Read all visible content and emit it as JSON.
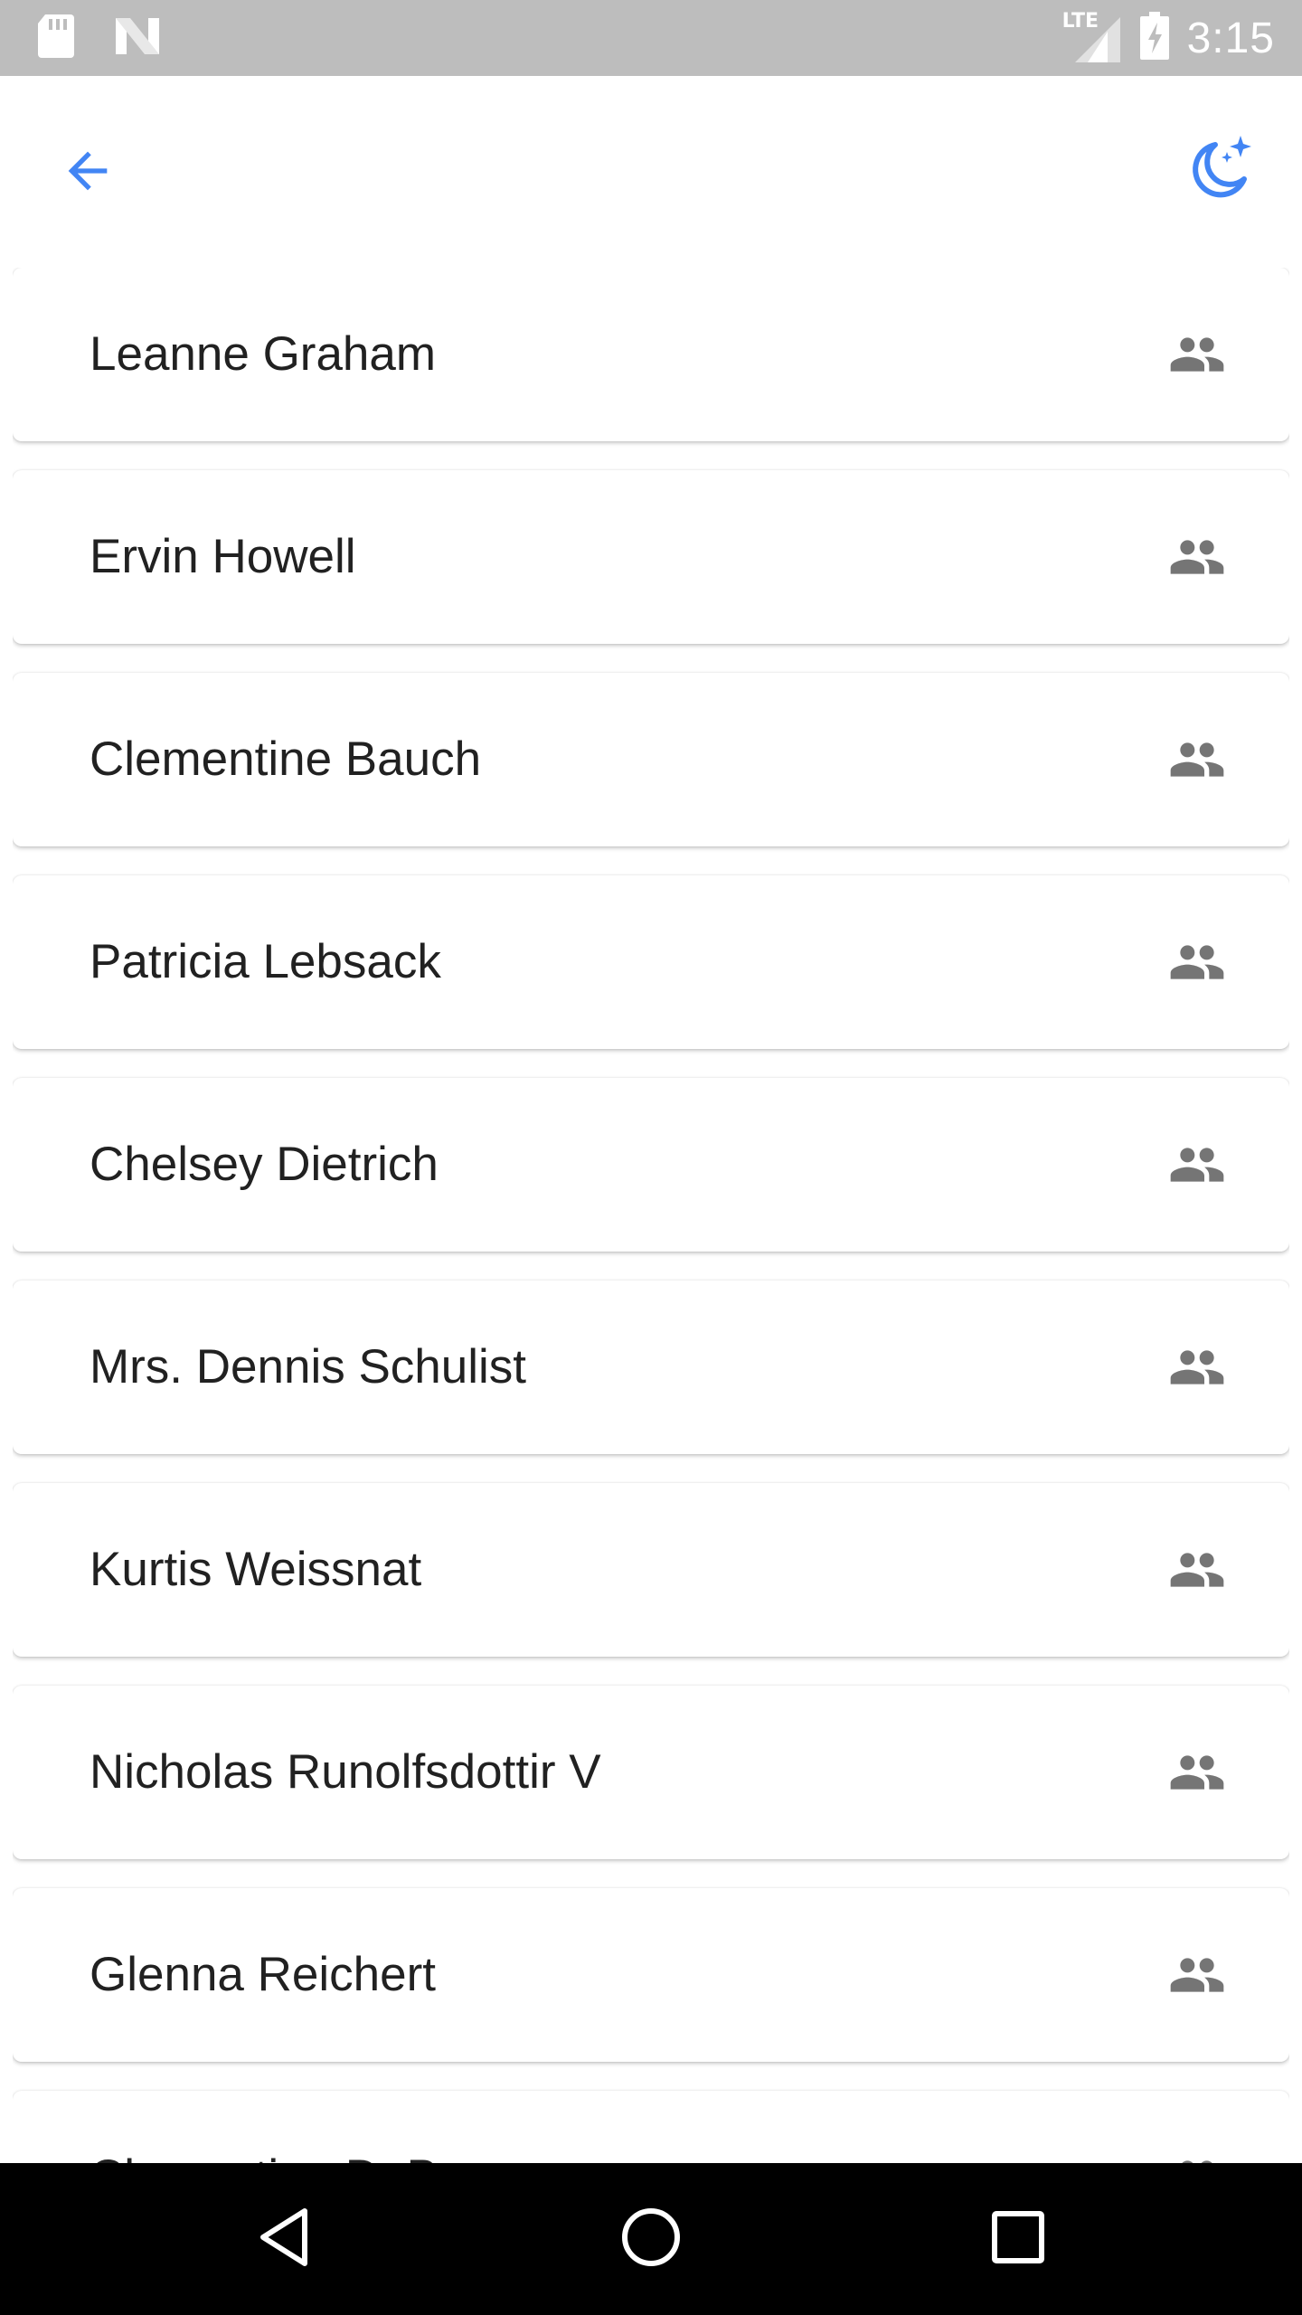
{
  "status_bar": {
    "left_icons": [
      "sd-card-icon",
      "n-notification-icon"
    ],
    "network_label": "LTE",
    "time": "3:15",
    "colors": {
      "background": "#bdbdbd",
      "foreground": "#ffffff"
    }
  },
  "app_bar": {
    "back_icon": "arrow-back-icon",
    "theme_icon": "night-mode-icon",
    "accent_color": "#4285f4"
  },
  "users": [
    {
      "name": "Leanne Graham"
    },
    {
      "name": "Ervin Howell"
    },
    {
      "name": "Clementine Bauch"
    },
    {
      "name": "Patricia Lebsack"
    },
    {
      "name": "Chelsey Dietrich"
    },
    {
      "name": "Mrs. Dennis Schulist"
    },
    {
      "name": "Kurtis Weissnat"
    },
    {
      "name": "Nicholas Runolfsdottir V"
    },
    {
      "name": "Glenna Reichert"
    },
    {
      "name": "Clementina DuBuque"
    }
  ],
  "list_item_icon": "group-icon",
  "list_icon_color": "#757575",
  "nav_bar": {
    "buttons": [
      "back-triangle-icon",
      "home-circle-icon",
      "recents-square-icon"
    ]
  }
}
